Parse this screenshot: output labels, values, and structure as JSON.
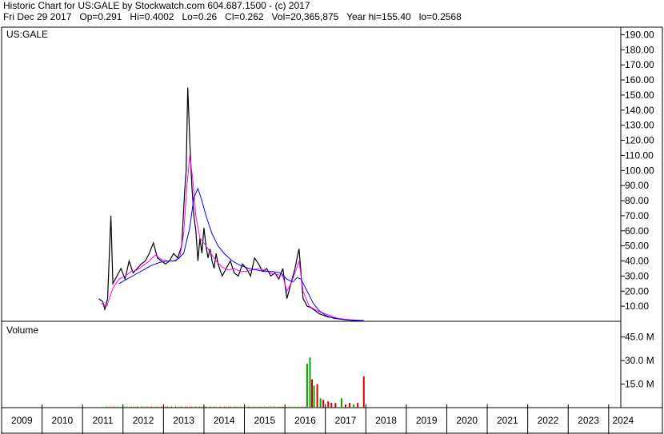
{
  "header": {
    "line1": "Historic Chart for US:GALE by Stockwatch.com 604.687.1500 - (c) 2017",
    "line2": "Fri Dec 29 2017   Op=0.291   Hi=0.4002   Lo=0.26   Cl=0.262   Vol=20,365,875   Year hi=155.40   lo=0.2568"
  },
  "chart_data": [
    {
      "type": "line",
      "panel": "price",
      "title": "US:GALE",
      "ylim": [
        0,
        195
      ],
      "yticks": [
        "10.00",
        "20.00",
        "30.00",
        "40.00",
        "50.00",
        "60.00",
        "70.00",
        "80.00",
        "90.00",
        "100.00",
        "110.00",
        "120.00",
        "130.00",
        "140.00",
        "150.00",
        "160.00",
        "170.00",
        "180.00",
        "190.00"
      ],
      "ytick_values": [
        10,
        20,
        30,
        40,
        50,
        60,
        70,
        80,
        90,
        100,
        110,
        120,
        130,
        140,
        150,
        160,
        170,
        180,
        190
      ],
      "xlim": [
        2009.0,
        2024.3
      ],
      "xticks": [
        "2009",
        "2010",
        "2011",
        "2012",
        "2013",
        "2014",
        "2015",
        "2016",
        "2017",
        "2018",
        "2019",
        "2020",
        "2021",
        "2022",
        "2023",
        "2024"
      ],
      "xtick_values": [
        2009,
        2010,
        2011,
        2012,
        2013,
        2014,
        2015,
        2016,
        2017,
        2018,
        2019,
        2020,
        2021,
        2022,
        2023,
        2024
      ],
      "grid": false,
      "colors": {
        "price": "#000000",
        "ma_short": "#ff00ff",
        "ma_long": "#0000ff"
      },
      "series": [
        {
          "role": "price",
          "x": [
            2011.4,
            2011.5,
            2011.55,
            2011.62,
            2011.7,
            2011.75,
            2011.85,
            2011.95,
            2012.05,
            2012.15,
            2012.25,
            2012.35,
            2012.45,
            2012.55,
            2012.65,
            2012.75,
            2012.85,
            2012.95,
            2013.05,
            2013.15,
            2013.25,
            2013.35,
            2013.45,
            2013.52,
            2013.56,
            2013.6,
            2013.65,
            2013.7,
            2013.75,
            2013.8,
            2013.85,
            2013.9,
            2013.95,
            2014.0,
            2014.05,
            2014.1,
            2014.15,
            2014.2,
            2014.25,
            2014.3,
            2014.35,
            2014.45,
            2014.55,
            2014.65,
            2014.75,
            2014.85,
            2014.95,
            2015.05,
            2015.15,
            2015.25,
            2015.35,
            2015.45,
            2015.55,
            2015.65,
            2015.75,
            2015.85,
            2015.95,
            2016.05,
            2016.1,
            2016.15,
            2016.2,
            2016.25,
            2016.3,
            2016.35,
            2016.45,
            2016.55,
            2016.65,
            2016.75,
            2016.85,
            2016.95,
            2017.05,
            2017.25,
            2017.5,
            2017.75,
            2017.95
          ],
          "y": [
            15,
            13,
            8,
            15,
            70,
            25,
            30,
            35,
            28,
            40,
            32,
            35,
            38,
            40,
            45,
            52,
            42,
            40,
            38,
            40,
            45,
            42,
            50,
            85,
            100,
            155,
            120,
            90,
            70,
            60,
            40,
            55,
            45,
            62,
            50,
            42,
            48,
            40,
            35,
            45,
            38,
            30,
            35,
            40,
            32,
            30,
            38,
            35,
            30,
            42,
            38,
            33,
            35,
            30,
            32,
            28,
            35,
            15,
            20,
            25,
            30,
            35,
            42,
            48,
            15,
            10,
            9,
            7,
            5,
            4,
            3,
            2,
            1,
            0.5,
            0.3
          ]
        },
        {
          "role": "moving-average-short",
          "x": [
            2011.45,
            2011.6,
            2011.75,
            2011.9,
            2012.05,
            2012.2,
            2012.35,
            2012.5,
            2012.65,
            2012.8,
            2012.95,
            2013.1,
            2013.25,
            2013.4,
            2013.5,
            2013.58,
            2013.65,
            2013.72,
            2013.8,
            2013.9,
            2014.0,
            2014.1,
            2014.2,
            2014.3,
            2014.45,
            2014.6,
            2014.75,
            2014.9,
            2015.05,
            2015.2,
            2015.35,
            2015.5,
            2015.65,
            2015.8,
            2015.95,
            2016.05,
            2016.15,
            2016.25,
            2016.35,
            2016.45,
            2016.6,
            2016.8,
            2017.0,
            2017.3,
            2017.6,
            2017.95
          ],
          "y": [
            12,
            10,
            22,
            28,
            30,
            33,
            34,
            37,
            40,
            44,
            41,
            40,
            40,
            42,
            58,
            90,
            110,
            95,
            70,
            55,
            52,
            48,
            44,
            40,
            36,
            34,
            35,
            33,
            33,
            34,
            35,
            34,
            32,
            31,
            30,
            20,
            25,
            32,
            40,
            20,
            10,
            7,
            5,
            2,
            1,
            0.4
          ]
        },
        {
          "role": "moving-average-long",
          "x": [
            2011.9,
            2012.1,
            2012.3,
            2012.5,
            2012.7,
            2012.9,
            2013.1,
            2013.3,
            2013.5,
            2013.65,
            2013.75,
            2013.85,
            2013.95,
            2014.05,
            2014.2,
            2014.35,
            2014.5,
            2014.7,
            2014.9,
            2015.1,
            2015.3,
            2015.5,
            2015.7,
            2015.9,
            2016.05,
            2016.2,
            2016.3,
            2016.4,
            2016.55,
            2016.7,
            2016.85,
            2017.0,
            2017.2,
            2017.5,
            2017.95
          ],
          "y": [
            25,
            28,
            31,
            34,
            37,
            39,
            40,
            40,
            45,
            62,
            82,
            88,
            80,
            70,
            58,
            50,
            45,
            40,
            37,
            35,
            34,
            33,
            33,
            32,
            28,
            26,
            29,
            28,
            20,
            12,
            7,
            4,
            2,
            1,
            0.6
          ]
        }
      ]
    },
    {
      "type": "bar",
      "panel": "volume",
      "title": "Volume",
      "ylim": [
        0,
        55
      ],
      "unit": "M",
      "yticks": [
        "15.0 M",
        "30.0 M",
        "45.0 M"
      ],
      "ytick_values": [
        15,
        30,
        45
      ],
      "colors": {
        "up": "#00aa00",
        "down": "#cc0000"
      },
      "bars": [
        {
          "x": 2016.55,
          "value": 28,
          "dir": "up"
        },
        {
          "x": 2016.62,
          "value": 32,
          "dir": "up"
        },
        {
          "x": 2016.67,
          "value": 18,
          "dir": "down"
        },
        {
          "x": 2016.72,
          "value": 14,
          "dir": "up"
        },
        {
          "x": 2016.8,
          "value": 15,
          "dir": "down"
        },
        {
          "x": 2016.88,
          "value": 6,
          "dir": "up"
        },
        {
          "x": 2016.95,
          "value": 5,
          "dir": "down"
        },
        {
          "x": 2017.07,
          "value": 4,
          "dir": "down"
        },
        {
          "x": 2017.15,
          "value": 3,
          "dir": "down"
        },
        {
          "x": 2017.25,
          "value": 3,
          "dir": "down"
        },
        {
          "x": 2017.4,
          "value": 6,
          "dir": "up"
        },
        {
          "x": 2017.5,
          "value": 2,
          "dir": "down"
        },
        {
          "x": 2017.6,
          "value": 3,
          "dir": "down"
        },
        {
          "x": 2017.7,
          "value": 2,
          "dir": "up"
        },
        {
          "x": 2017.8,
          "value": 3,
          "dir": "down"
        },
        {
          "x": 2017.95,
          "value": 20,
          "dir": "down"
        }
      ],
      "background_volume": {
        "x_start": 2011.6,
        "x_end": 2016.5,
        "value": 0.8
      }
    }
  ]
}
